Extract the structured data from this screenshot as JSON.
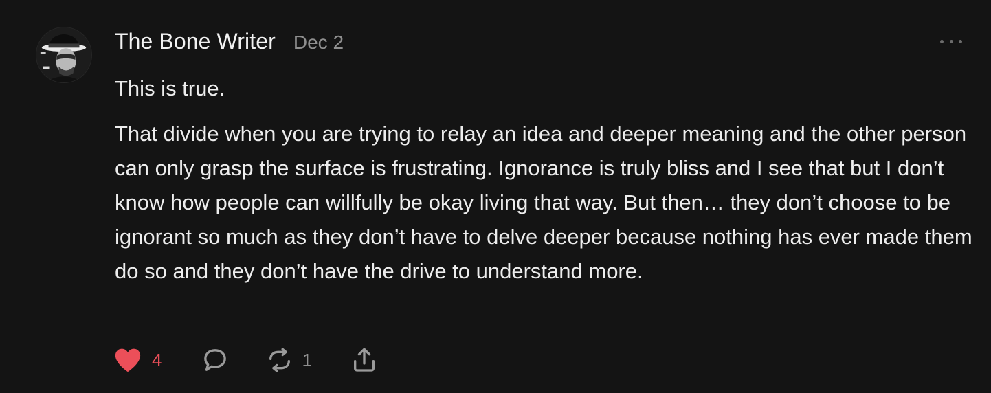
{
  "post": {
    "author_name": "The Bone Writer",
    "date": "Dec 2",
    "paragraphs": [
      "This is true.",
      "That divide when you are trying to relay an idea and deeper meaning and the other person can only grasp the surface is frustrating. Ignorance is truly bliss and I see that but I don’t know how people can willfully be okay living that way. But then… they don’t choose to be ignorant so much as they don’t have to delve deeper because nothing has ever made them do so and they don’t have the drive to understand more."
    ]
  },
  "actions": {
    "like": {
      "icon": "heart-icon",
      "count": "4",
      "color": "#ec4f59",
      "liked": true
    },
    "comment": {
      "icon": "comment-icon"
    },
    "repost": {
      "icon": "repost-icon",
      "count": "1"
    },
    "share": {
      "icon": "share-icon"
    }
  },
  "colors": {
    "background": "#141414",
    "text": "#ededed",
    "muted": "#8f8f8f",
    "icon": "#9a9a9a"
  }
}
